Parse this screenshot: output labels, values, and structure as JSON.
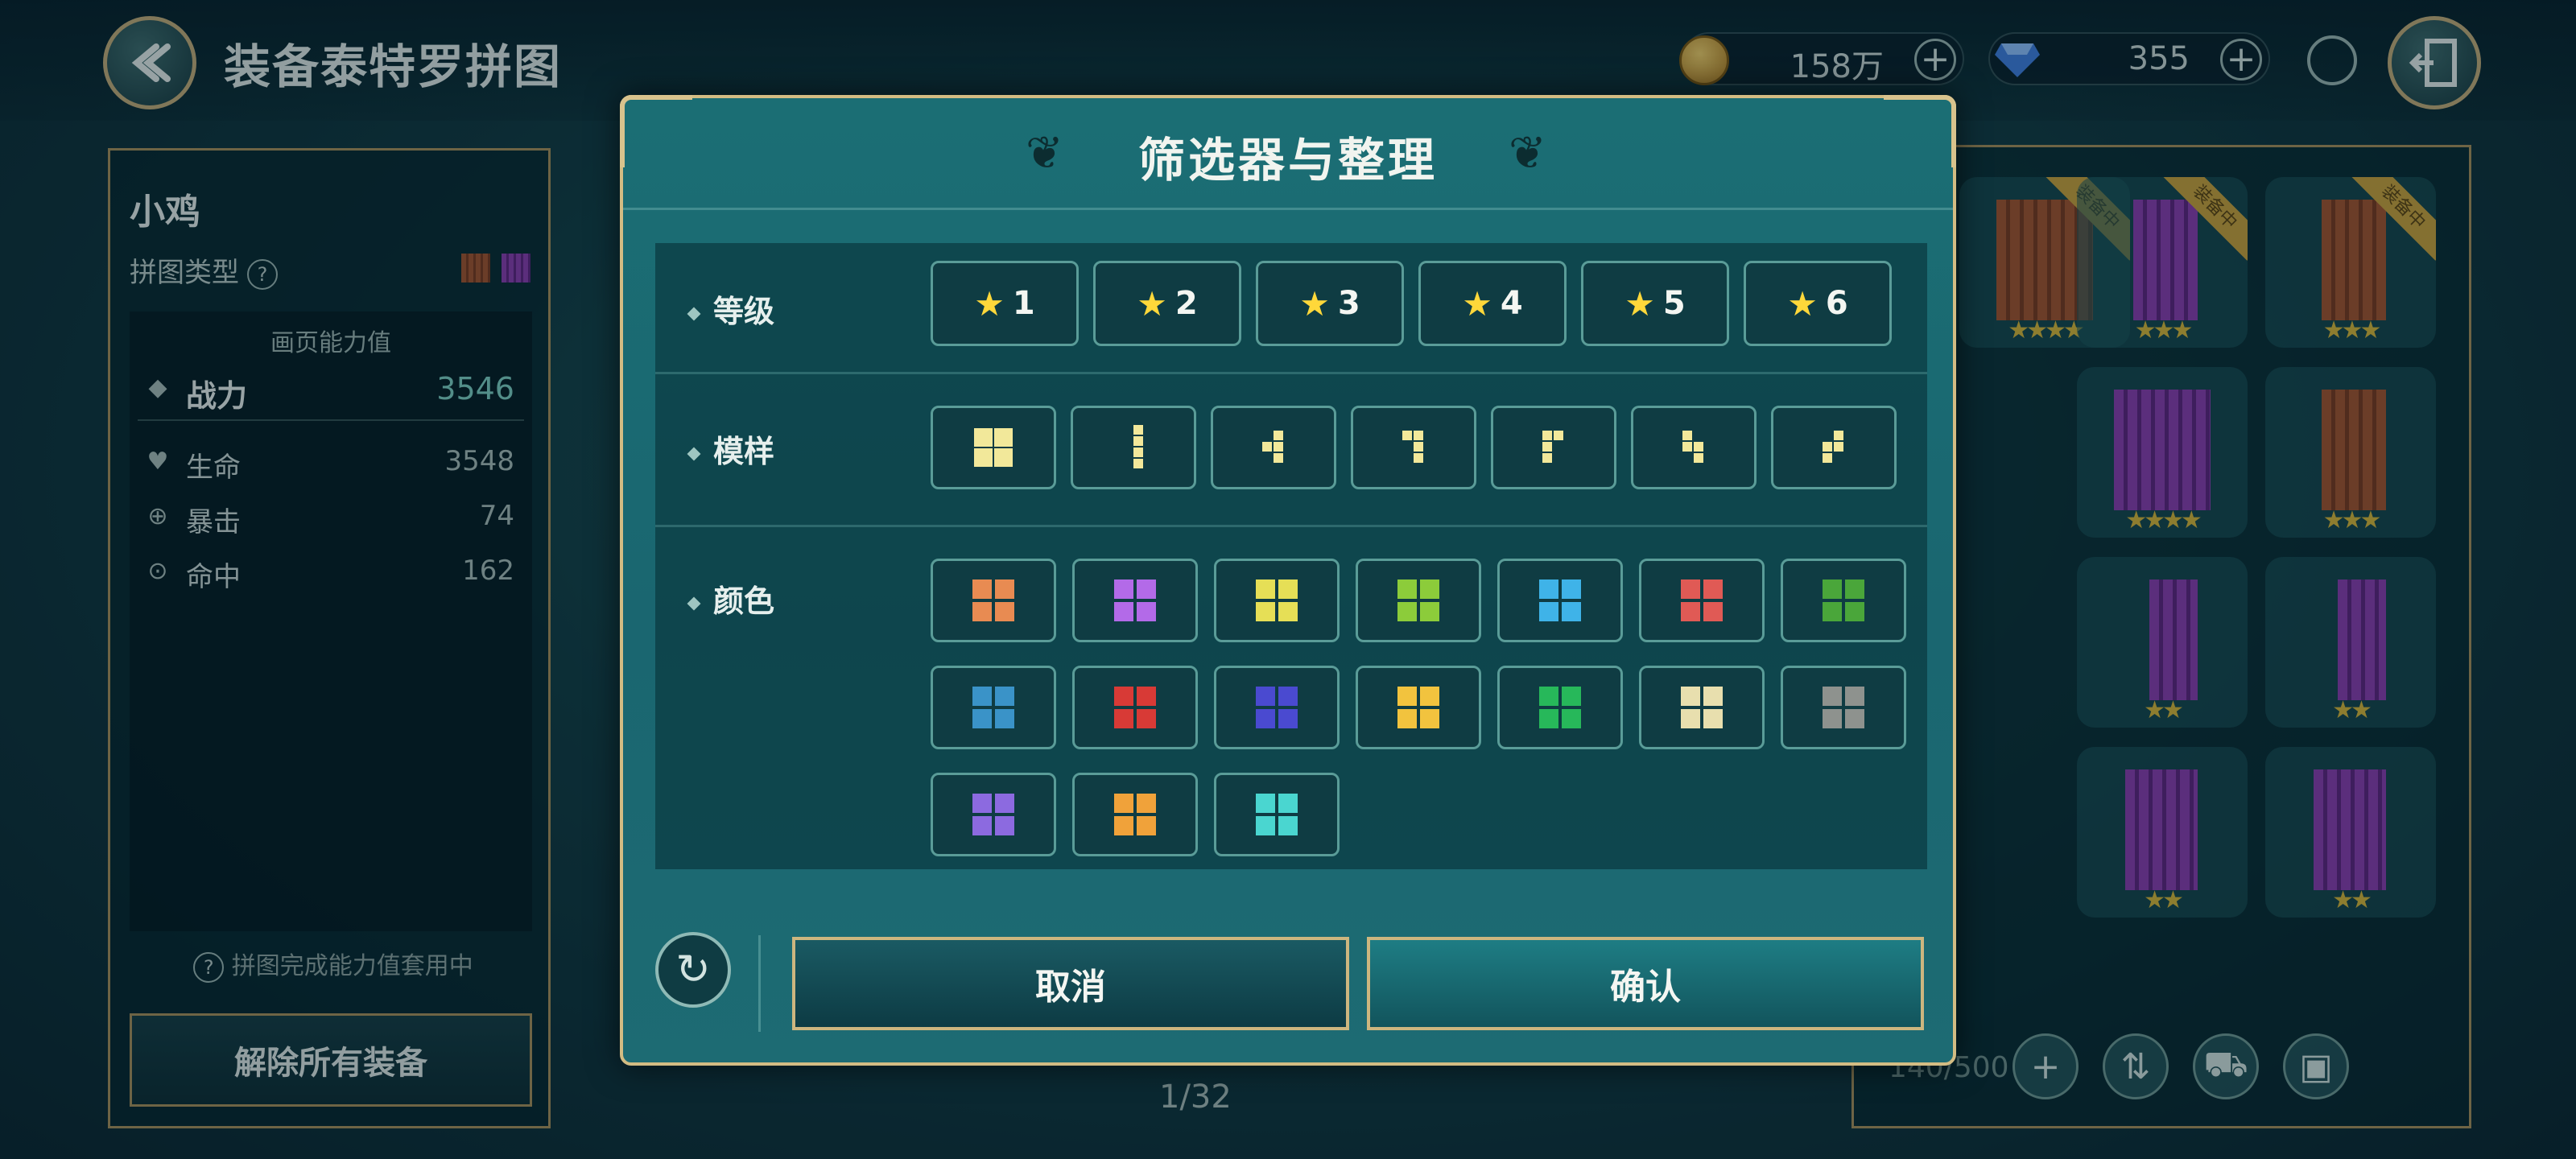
{
  "header": {
    "title": "装备泰特罗拼图",
    "gold_value": "158万",
    "gem_value": "355"
  },
  "left_panel": {
    "character_name": "小鸡",
    "puzzle_type_label": "拼图类型",
    "stats_header": "画页能力值",
    "power": {
      "label": "战力",
      "value": "3546"
    },
    "stats": [
      {
        "icon": "heart-icon",
        "label": "生命",
        "value": "3548"
      },
      {
        "icon": "crit-icon",
        "label": "暴击",
        "value": "74"
      },
      {
        "icon": "hit-icon",
        "label": "命中",
        "value": "162"
      }
    ],
    "bonus_note": "拼图完成能力值套用中",
    "unequip_all_label": "解除所有装备"
  },
  "page_indicator": "1/32",
  "inventory": {
    "count_text": "140/500",
    "equipped_ribbon": "装备中"
  },
  "dialog": {
    "title": "筛选器与整理",
    "sections": {
      "grade_label": "等级",
      "shape_label": "模样",
      "color_label": "颜色"
    },
    "grade_options": [
      "1",
      "2",
      "3",
      "4",
      "5",
      "6"
    ],
    "shape_options": [
      "square",
      "line-i",
      "t-shape",
      "j-shape",
      "l-shape",
      "s-shape",
      "z-shape"
    ],
    "color_options": [
      "#e88b52",
      "#b36ae8",
      "#e6df56",
      "#8ccc3a",
      "#3fb3e8",
      "#e05a55",
      "#4aa63a",
      "#3a93c8",
      "#d83a36",
      "#4a4ad0",
      "#f2c33e",
      "#27b85a",
      "#e8dfae",
      "#8e928e",
      "#8c6ae0",
      "#f0a23a",
      "#4ad6d0"
    ],
    "cancel_label": "取消",
    "confirm_label": "确认"
  },
  "colors": {
    "accent_gold": "#d3bc83",
    "dialog_teal": "#1b6e74",
    "star_yellow": "#ffd83a"
  }
}
